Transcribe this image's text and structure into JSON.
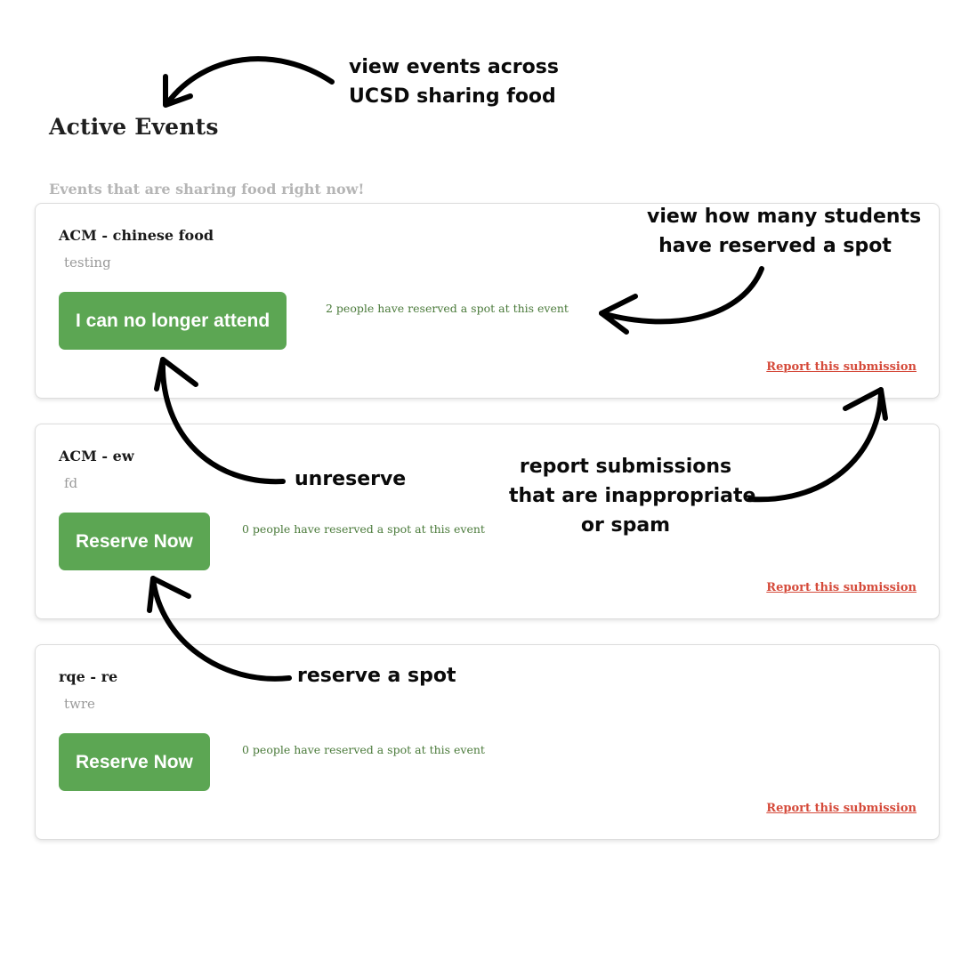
{
  "header": {
    "title": "Active Events",
    "subtitle": "Events that are sharing food right now!"
  },
  "events": [
    {
      "title": "ACM - chinese food",
      "description": "testing",
      "button_label": "I can no longer attend",
      "reserved_text": "2 people have reserved a spot at this event",
      "report_label": "Report this submission"
    },
    {
      "title": "ACM - ew",
      "description": "fd",
      "button_label": "Reserve Now",
      "reserved_text": "0 people have reserved a spot at this event",
      "report_label": "Report this submission"
    },
    {
      "title": "rqe - re",
      "description": "twre",
      "button_label": "Reserve Now",
      "reserved_text": "0 people have reserved a spot at this event",
      "report_label": "Report this submission"
    }
  ],
  "annotations": {
    "view_events": [
      "view events across",
      "UCSD sharing food"
    ],
    "view_reservations": [
      "view how many students",
      "have reserved a spot"
    ],
    "unreserve": "unreserve",
    "report": [
      "report submissions",
      "that are inappropriate",
      "or spam"
    ],
    "reserve": "reserve a spot"
  },
  "colors": {
    "button_green": "#5ca653",
    "reserved_text": "#4a7a3a",
    "report_red": "#d54a3a",
    "subtitle_gray": "#b5b5b5"
  }
}
